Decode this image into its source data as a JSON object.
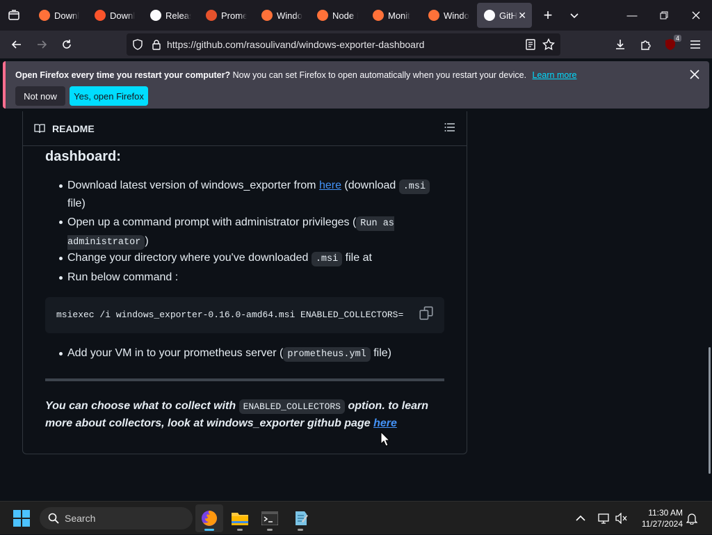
{
  "browser": {
    "tabs": [
      {
        "label": "Downl",
        "icon": "firefox-icon",
        "active": false
      },
      {
        "label": "Downl",
        "icon": "brave-icon",
        "active": false
      },
      {
        "label": "Releas",
        "icon": "github-icon",
        "active": false
      },
      {
        "label": "Prome",
        "icon": "prometheus-icon",
        "active": false
      },
      {
        "label": "Windo",
        "icon": "firefox-icon",
        "active": false
      },
      {
        "label": "Node I",
        "icon": "firefox-icon",
        "active": false
      },
      {
        "label": "Monit",
        "icon": "firefox-icon",
        "active": false
      },
      {
        "label": "Windo",
        "icon": "firefox-icon",
        "active": false
      },
      {
        "label": "GitH",
        "icon": "github-icon",
        "active": true
      }
    ],
    "url": "https://github.com/rasoulivand/windows-exporter-dashboard",
    "extension_badge": "4"
  },
  "notification": {
    "bold": "Open Firefox every time you restart your computer?",
    "text": "Now you can set Firefox to open automatically when you restart your device.",
    "link": "Learn more",
    "not_now": "Not now",
    "yes": "Yes, open Firefox"
  },
  "readme": {
    "header_label": "README",
    "heading_fragment": "dashboard:",
    "list1": [
      {
        "before": "Download latest version of windows_exporter from ",
        "link": "here",
        "middle": " (download ",
        "code": ".msi",
        "after": " file)"
      },
      {
        "before": "Open up a command prompt with administrator privileges (",
        "code": "Run as administrator",
        "after": ")"
      },
      {
        "before": "Change your directory where you've downloaded ",
        "code": ".msi",
        "after": " file at"
      },
      {
        "before": "Run below command :"
      }
    ],
    "code_block": "msiexec /i windows_exporter-0.16.0-amd64.msi ENABLED_COLLECTORS=",
    "list2": [
      {
        "before": "Add your VM in to your prometheus server (",
        "code": "prometheus.yml",
        "after": " file)"
      }
    ],
    "italic_p1": "You can choose what to collect with ",
    "italic_code": "ENABLED_COLLECTORS",
    "italic_p2": " option. to learn more about collectors, look at windows_exporter github page ",
    "italic_link": "here"
  },
  "taskbar": {
    "search_placeholder": "Search",
    "time": "11:30 AM",
    "date": "11/27/2024"
  },
  "colors": {
    "accent": "#00ddff",
    "link": "#4493f8"
  }
}
